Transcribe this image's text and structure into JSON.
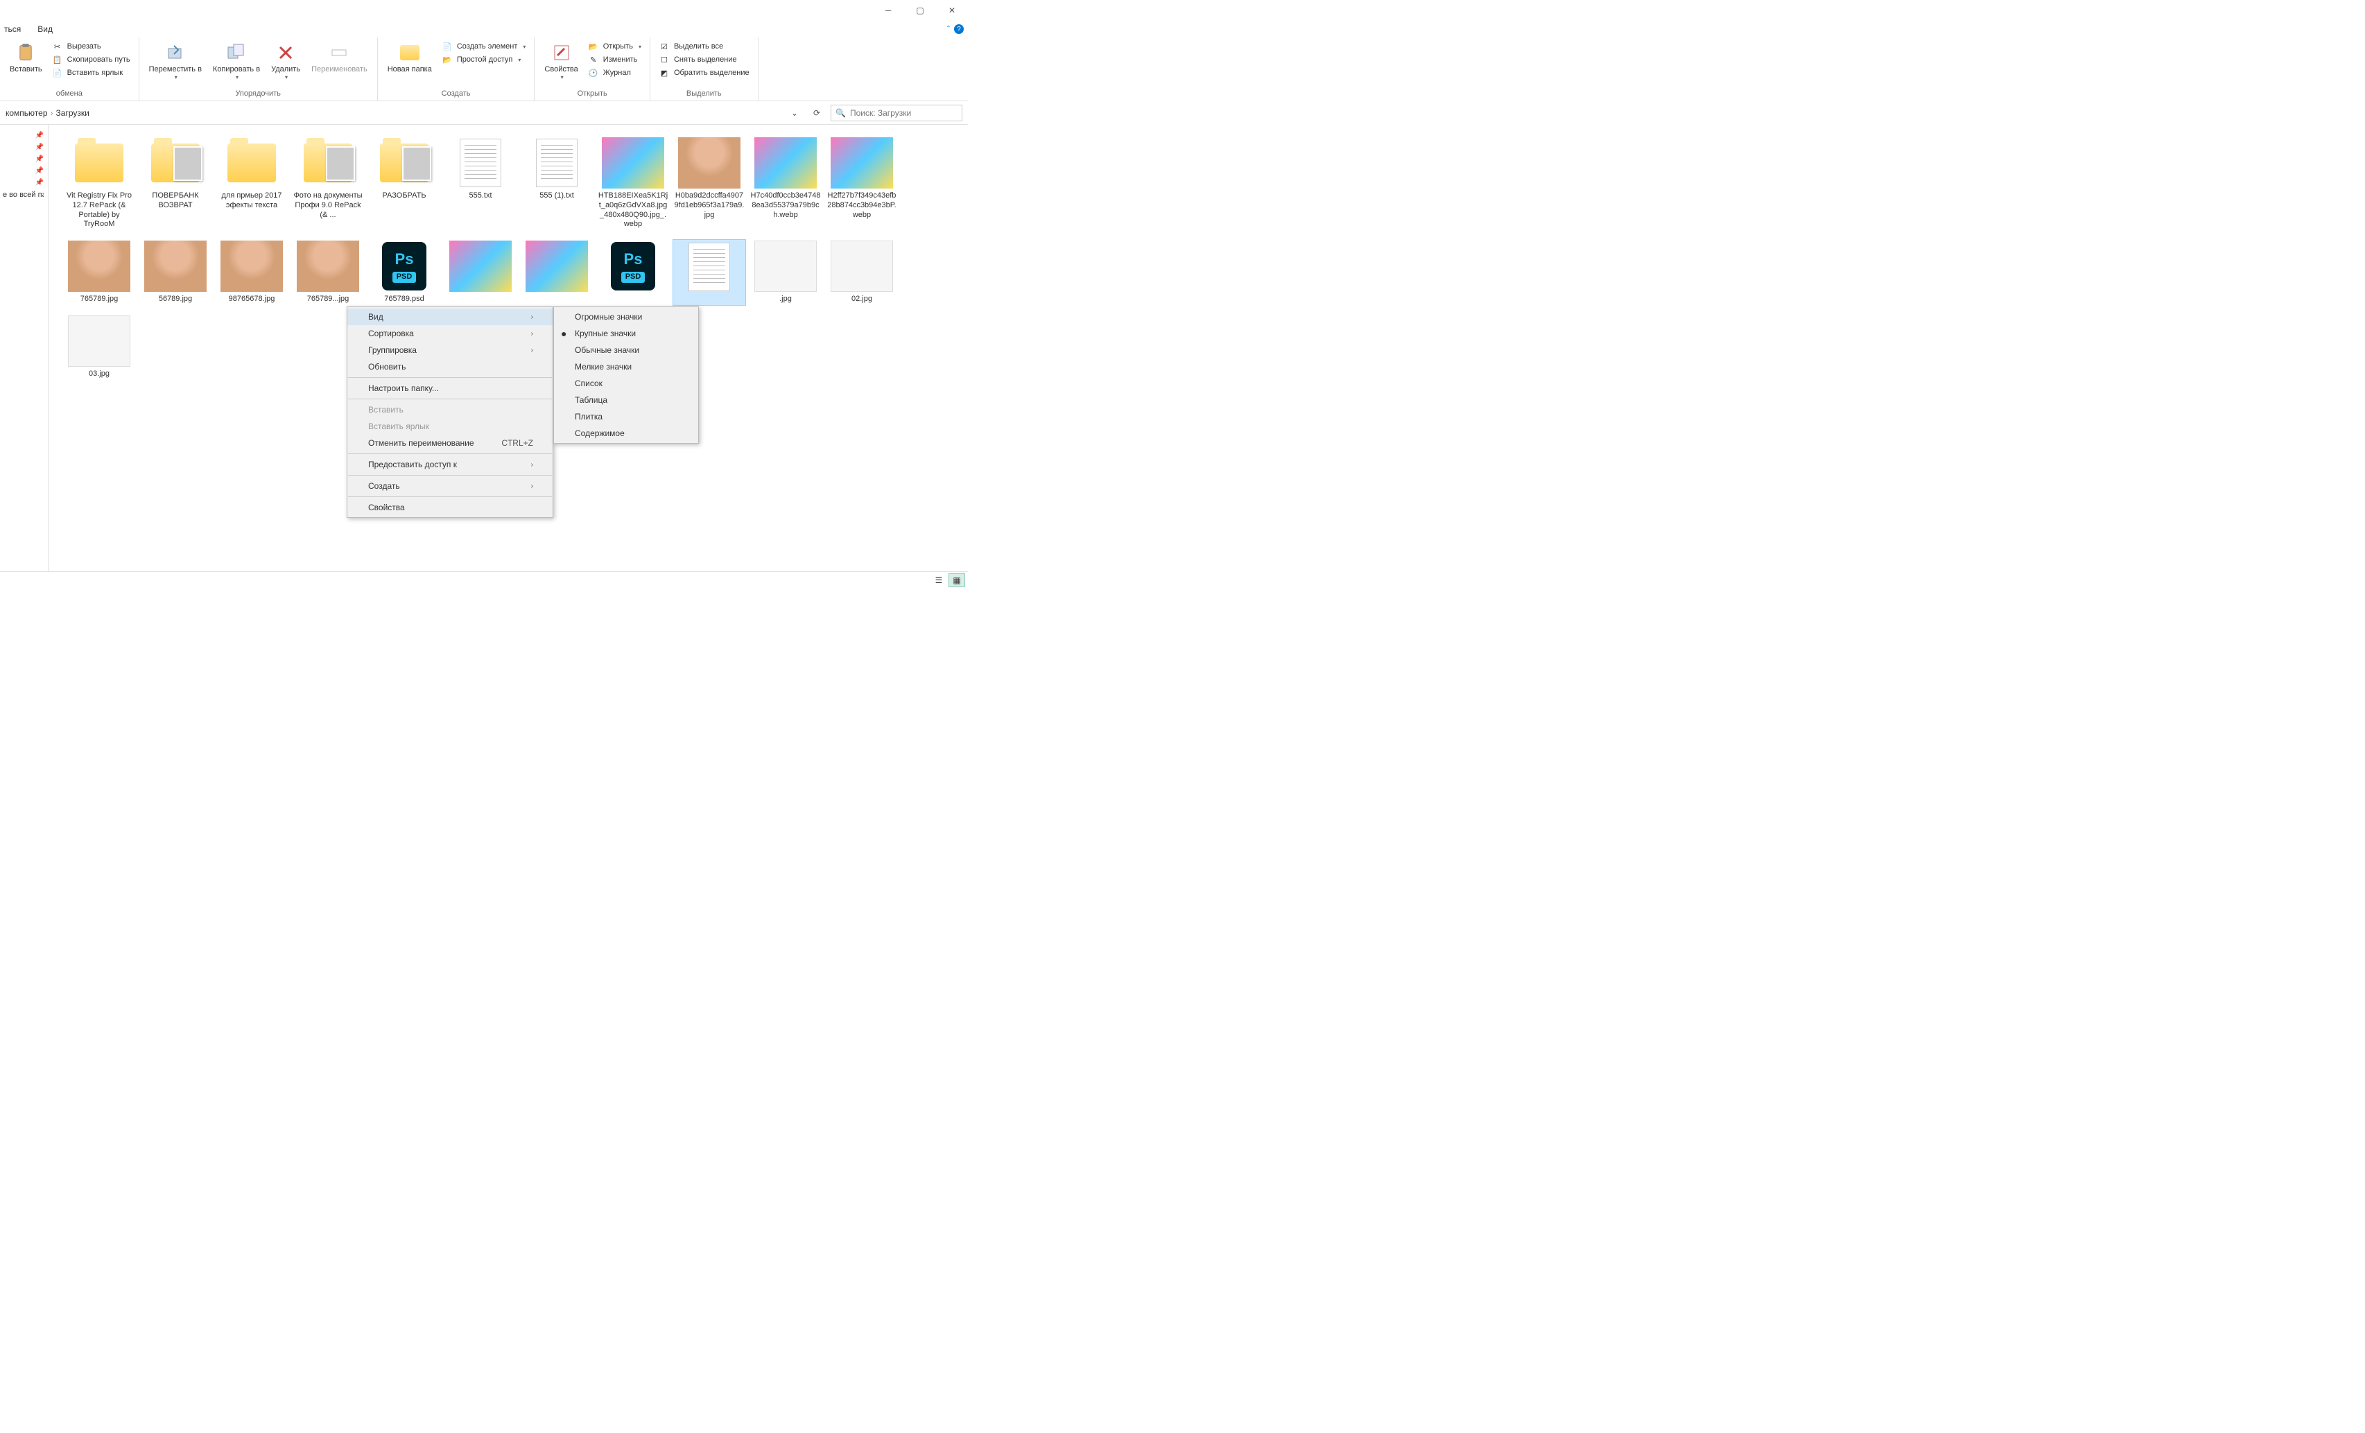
{
  "tabs": {
    "share": "ться",
    "view": "Вид"
  },
  "ribbon": {
    "clipboard": {
      "paste": "Вставить",
      "cut": "Вырезать",
      "copy_path": "Скопировать путь",
      "paste_shortcut": "Вставить ярлык",
      "label": "обмена"
    },
    "organize": {
      "move_to": "Переместить в",
      "copy_to": "Копировать в",
      "delete": "Удалить",
      "rename": "Переименовать",
      "label": "Упорядочить"
    },
    "new": {
      "new_folder": "Новая папка",
      "new_item": "Создать элемент",
      "easy_access": "Простой доступ",
      "label": "Создать"
    },
    "open": {
      "properties": "Свойства",
      "open": "Открыть",
      "edit": "Изменить",
      "history": "Журнал",
      "label": "Открыть"
    },
    "select": {
      "select_all": "Выделить все",
      "select_none": "Снять выделение",
      "invert": "Обратить выделение",
      "label": "Выделить"
    }
  },
  "breadcrumb": {
    "pc": "компьютер",
    "downloads": "Загрузки"
  },
  "search": {
    "placeholder": "Поиск: Загрузки"
  },
  "sidebar": {
    "text": "е во всей паг"
  },
  "files": [
    {
      "name": "Vit Registry Fix Pro 12.7 RePack (& Portable) by TryRooM",
      "type": "folder"
    },
    {
      "name": "ПОВЕРБАНК ВОЗВРАТ",
      "type": "folder-preview"
    },
    {
      "name": "для прмьер 2017 эфекты текста",
      "type": "folder"
    },
    {
      "name": "Фото на документы Профи 9.0 RePack (& ...",
      "type": "folder-preview"
    },
    {
      "name": "РАЗОБРАТЬ",
      "type": "folder-preview"
    },
    {
      "name": "555.txt",
      "type": "text"
    },
    {
      "name": "555 (1).txt",
      "type": "text"
    },
    {
      "name": "HTB188EIXea5K1Rjt_a0q6zGdVXa8.jpg_480x480Q90.jpg_.webp",
      "type": "image"
    },
    {
      "name": "H0ba9d2dccffa49079fd1eb965f3a179a9.jpg",
      "type": "image-swimsuit"
    },
    {
      "name": "H7c40df0ccb3e47488ea3d55379a79b9ch.webp",
      "type": "image"
    },
    {
      "name": "H2ff27b7f349c43efb28b874cc3b94e3bP.webp",
      "type": "image"
    },
    {
      "name": "765789.jpg",
      "type": "image-swimsuit"
    },
    {
      "name": "56789.jpg",
      "type": "image-swimsuit"
    },
    {
      "name": "98765678.jpg",
      "type": "image-swimsuit"
    },
    {
      "name": "765789...jpg",
      "type": "image-swimsuit"
    },
    {
      "name": "765789.psd",
      "type": "psd"
    },
    {
      "name": "",
      "type": "image"
    },
    {
      "name": "",
      "type": "image"
    },
    {
      "name": "",
      "type": "psd"
    },
    {
      "name": "",
      "type": "text",
      "selected": true
    },
    {
      "name": ".jpg",
      "type": "image-screenshot"
    },
    {
      "name": "02.jpg",
      "type": "image-screenshot"
    },
    {
      "name": "03.jpg",
      "type": "image-screenshot"
    }
  ],
  "context_menu": {
    "view": "Вид",
    "sort": "Сортировка",
    "group": "Группировка",
    "refresh": "Обновить",
    "customize": "Настроить папку...",
    "paste": "Вставить",
    "paste_shortcut": "Вставить ярлык",
    "undo_rename": "Отменить переименование",
    "undo_shortcut": "CTRL+Z",
    "grant_access": "Предоставить доступ к",
    "new": "Создать",
    "properties": "Свойства"
  },
  "submenu": {
    "huge": "Огромные значки",
    "large": "Крупные значки",
    "medium": "Обычные значки",
    "small": "Мелкие значки",
    "list": "Список",
    "details": "Таблица",
    "tiles": "Плитка",
    "content": "Содержимое"
  }
}
